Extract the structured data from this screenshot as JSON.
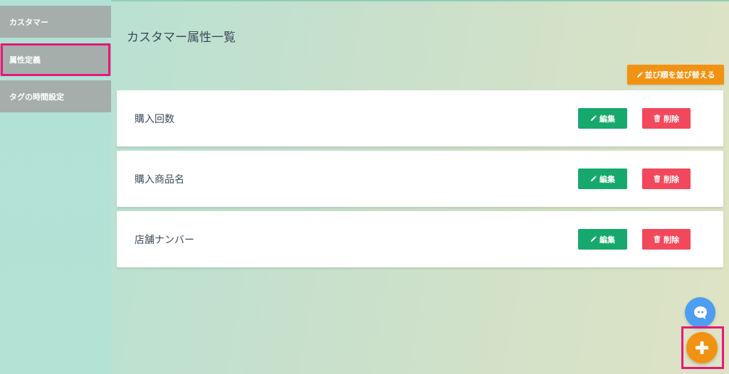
{
  "sidebar": {
    "items": [
      {
        "label": "カスタマー"
      },
      {
        "label": "属性定義"
      },
      {
        "label": "タグの時間設定"
      }
    ]
  },
  "main": {
    "title": "カスタマー属性一覧",
    "sort_button_label": "並び順を並び替える",
    "attributes": [
      {
        "name": "購入回数"
      },
      {
        "name": "購入商品名"
      },
      {
        "name": "店舗ナンバー"
      }
    ],
    "edit_label": "編集",
    "delete_label": "削除"
  },
  "colors": {
    "accent_orange": "#f29213",
    "edit_green": "#16a86d",
    "delete_red": "#f2485b",
    "highlight_pink": "#e6177a",
    "chat_blue": "#4d9df0"
  },
  "icons": {
    "sort": "pencil-icon",
    "edit": "pencil-icon",
    "delete": "trash-icon",
    "chat": "chat-bubble-icon",
    "add": "plus-icon"
  }
}
